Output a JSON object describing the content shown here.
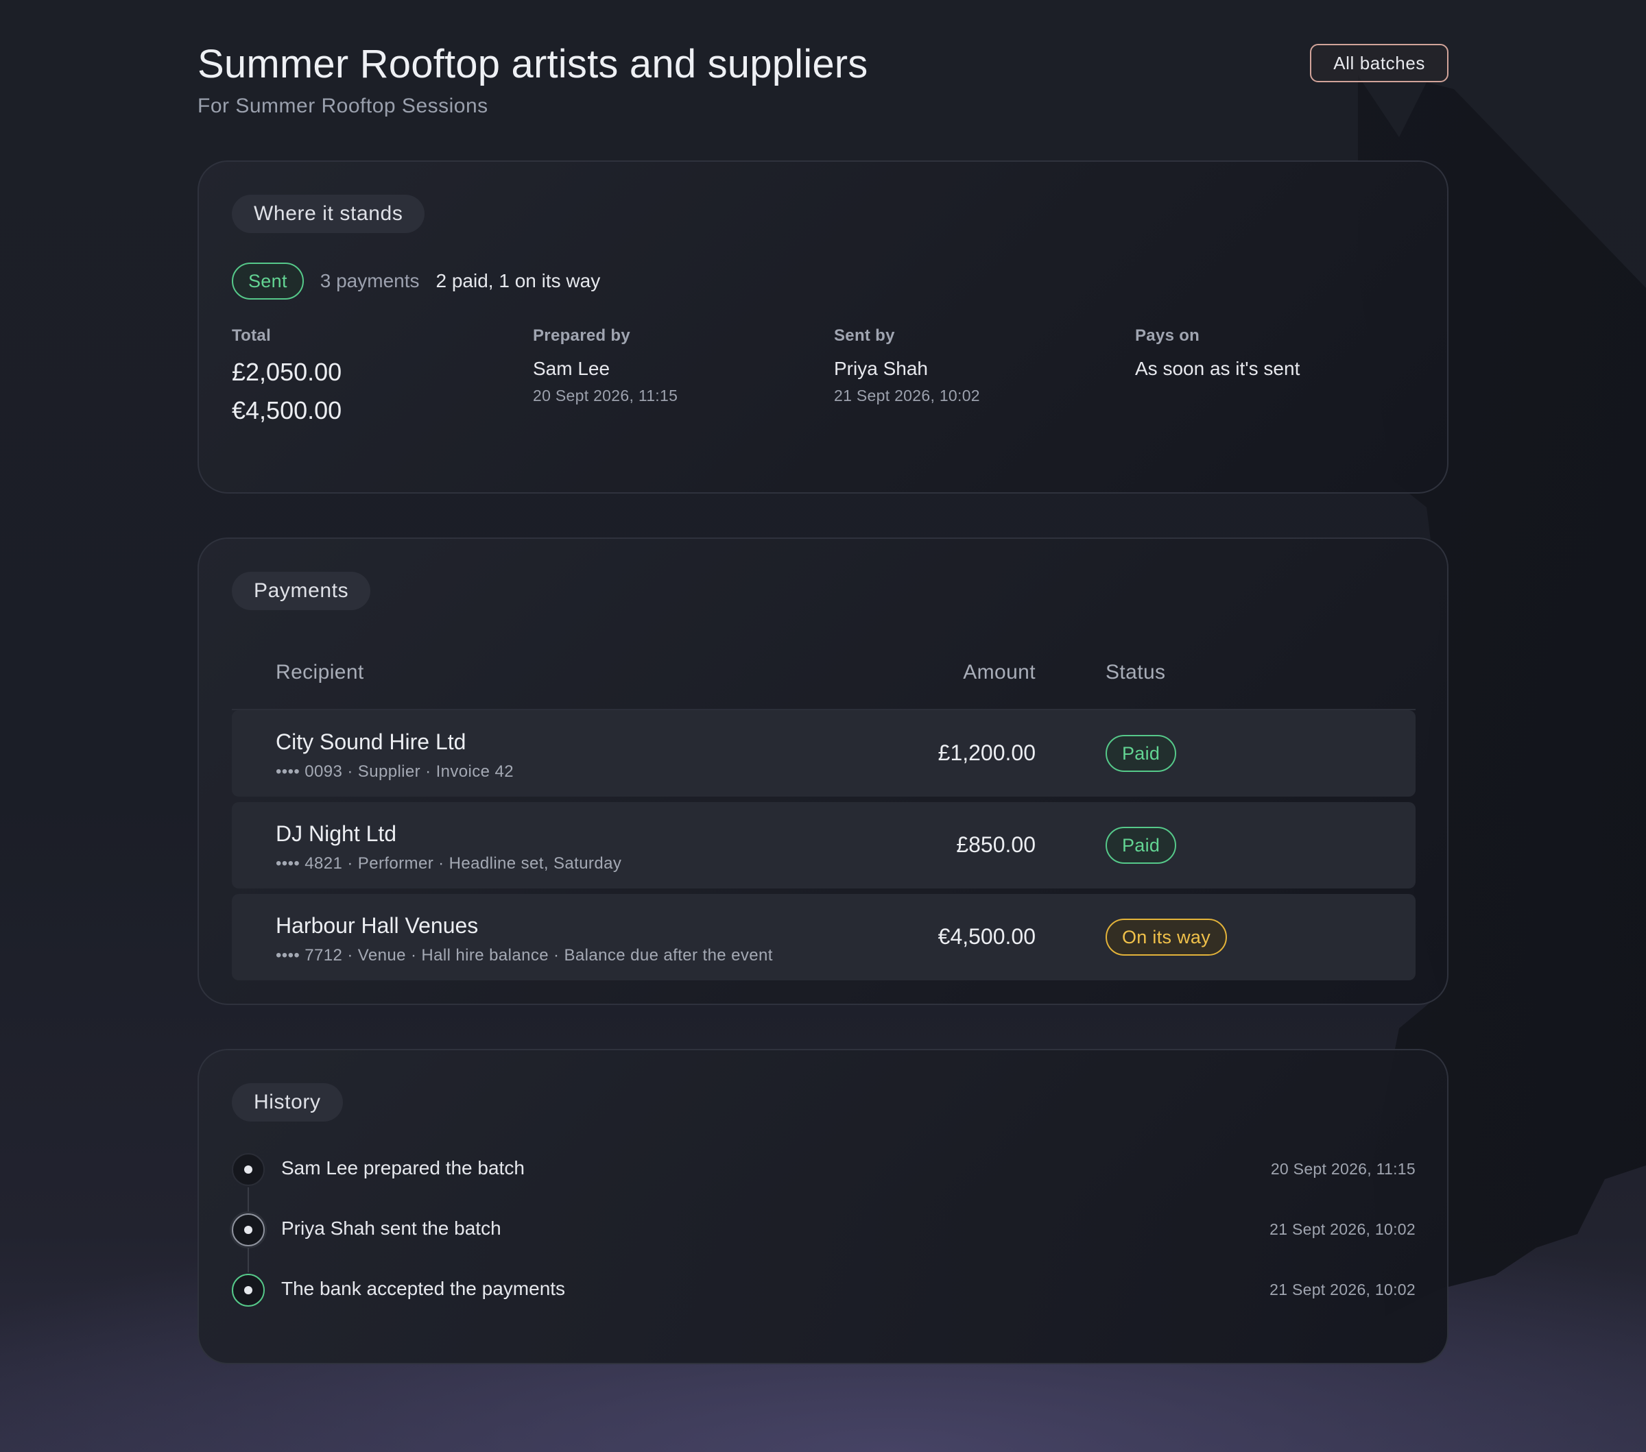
{
  "header": {
    "title": "Summer Rooftop artists and suppliers",
    "subtitle": "For Summer Rooftop Sessions",
    "all_batches_label": "All batches"
  },
  "status_card": {
    "tag": "Where it stands",
    "status_pill": "Sent",
    "payments_count": "3 payments",
    "summary": "2 paid, 1 on its way",
    "total": {
      "label": "Total",
      "values": [
        "£2,050.00",
        "€4,500.00"
      ]
    },
    "prepared_by": {
      "label": "Prepared by",
      "name": "Sam Lee",
      "time": "20 Sept 2026, 11:15"
    },
    "sent_by": {
      "label": "Sent by",
      "name": "Priya Shah",
      "time": "21 Sept 2026, 10:02"
    },
    "pays_on": {
      "label": "Pays on",
      "value": "As soon as it's sent"
    }
  },
  "payments_card": {
    "tag": "Payments",
    "columns": {
      "recipient": "Recipient",
      "amount": "Amount",
      "status": "Status"
    },
    "rows": [
      {
        "name": "City Sound Hire Ltd",
        "meta": "•••• 0093 · Supplier · Invoice 42",
        "amount": "£1,200.00",
        "status": "Paid"
      },
      {
        "name": "DJ Night Ltd",
        "meta": "•••• 4821 · Performer · Headline set, Saturday",
        "amount": "£850.00",
        "status": "Paid"
      },
      {
        "name": "Harbour Hall Venues",
        "meta": "•••• 7712 · Venue · Hall hire balance · Balance due after the event",
        "amount": "€4,500.00",
        "status": "On its way"
      }
    ]
  },
  "history_card": {
    "tag": "History",
    "events": [
      {
        "text": "Sam Lee prepared the batch",
        "time": "20 Sept 2026, 11:15"
      },
      {
        "text": "Priya Shah sent the batch",
        "time": "21 Sept 2026, 10:02"
      },
      {
        "text": "The bank accepted the payments",
        "time": "21 Sept 2026, 10:02"
      }
    ]
  },
  "colors": {
    "paid_green": "#56c98a",
    "on_its_way_amber": "#e3b33a",
    "button_border": "#d2a49a"
  }
}
